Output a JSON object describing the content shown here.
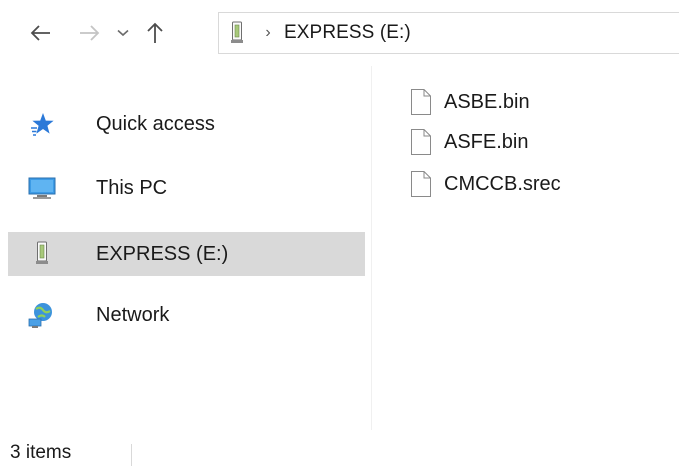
{
  "navigation": {
    "back_icon": "arrow-left-icon",
    "forward_icon": "arrow-right-icon",
    "recent_icon": "chevron-down-icon",
    "up_icon": "arrow-up-icon"
  },
  "address_bar": {
    "drive_icon": "usb-drive-icon",
    "separator": "›",
    "crumbs": [
      "EXPRESS (E:)"
    ]
  },
  "sidebar": {
    "items": [
      {
        "label": "Quick access",
        "icon": "star-icon",
        "selected": false
      },
      {
        "label": "This PC",
        "icon": "monitor-icon",
        "selected": false
      },
      {
        "label": "EXPRESS (E:)",
        "icon": "usb-drive-icon",
        "selected": true
      },
      {
        "label": "Network",
        "icon": "network-icon",
        "selected": false
      }
    ]
  },
  "files": [
    {
      "name": "ASBE.bin",
      "icon": "file-icon"
    },
    {
      "name": "ASFE.bin",
      "icon": "file-icon"
    },
    {
      "name": "CMCCB.srec",
      "icon": "file-icon"
    }
  ],
  "status_bar": {
    "item_count": "3 items"
  },
  "colors": {
    "selected_bg": "#d9d9d9",
    "star_blue": "#2b79d8",
    "monitor_blue": "#3c9be6"
  }
}
